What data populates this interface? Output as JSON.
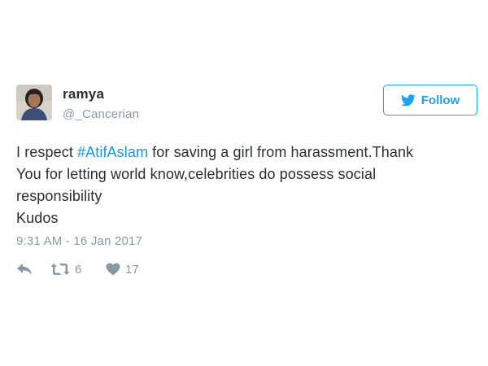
{
  "user": {
    "display_name": "ramya",
    "handle": "@_Cancerian",
    "avatar_icon": "profile-photo"
  },
  "follow_button": {
    "label": "Follow",
    "icon": "twitter-bird-icon"
  },
  "tweet": {
    "lines": [
      {
        "before": "I respect ",
        "hashtag": "#AtifAslam",
        "after": " for saving a girl from harassment.Thank"
      },
      {
        "text": "You for letting world know,celebrities do possess social"
      },
      {
        "text": "responsibility"
      },
      {
        "text": "Kudos"
      }
    ],
    "timestamp": "9:31 AM - 16 Jan 2017"
  },
  "actions": {
    "reply_icon": "reply-icon",
    "retweet_icon": "retweet-icon",
    "retweet_count": "6",
    "like_icon": "heart-icon",
    "like_count": "17"
  },
  "colors": {
    "text": "#292f33",
    "muted": "#8899a6",
    "accent": "#1da1f2",
    "hashtag": "#1b95e0"
  }
}
